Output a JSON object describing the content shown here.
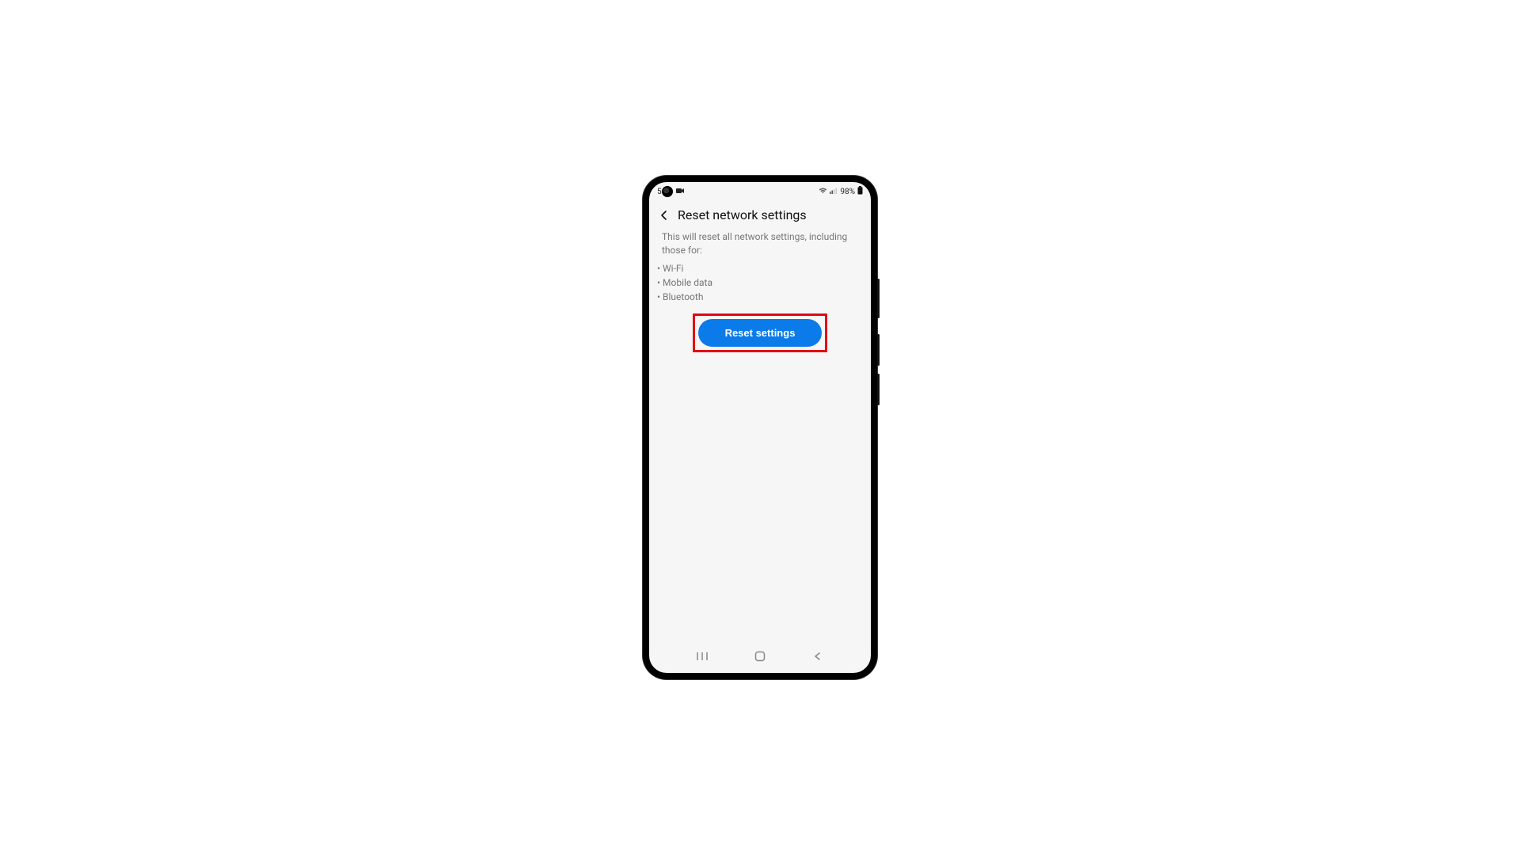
{
  "status": {
    "time_prefix": "5",
    "battery_text": "98%"
  },
  "header": {
    "title": "Reset network settings"
  },
  "body": {
    "intro": "This will reset all network settings, including those for:",
    "bullets": [
      "Wi-Fi",
      "Mobile data",
      "Bluetooth"
    ]
  },
  "actions": {
    "reset_label": "Reset settings"
  },
  "colors": {
    "accent": "#0b7bea",
    "highlight": "#e30613"
  }
}
